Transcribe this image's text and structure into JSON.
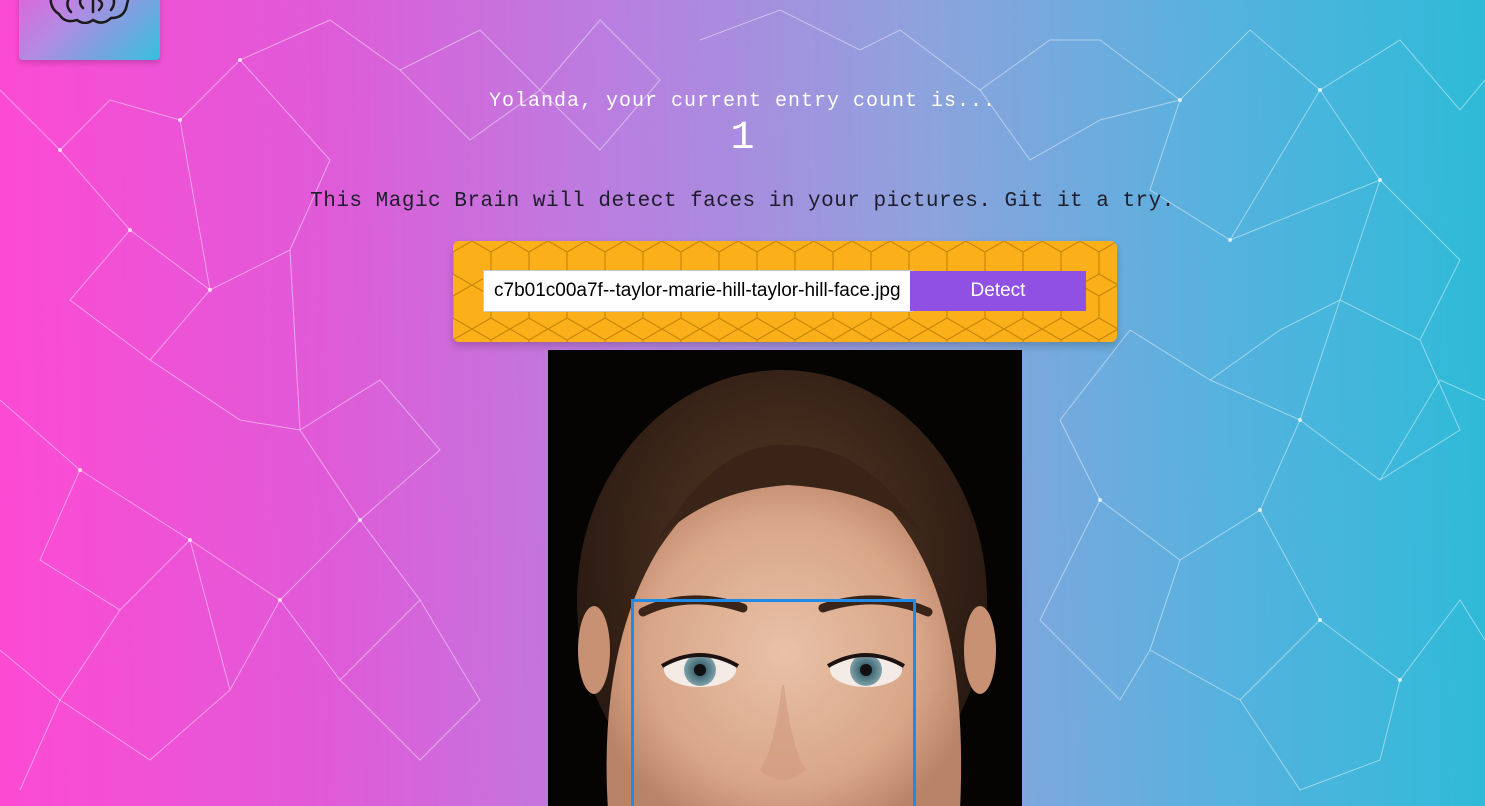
{
  "app": {
    "logo_icon": "brain-icon",
    "colors": {
      "gradient_start": "#fd4ad3",
      "gradient_end": "#2ebbd8",
      "form_background": "#fbb019",
      "button": "#9150e4",
      "bounding_box": "#1f8be8"
    }
  },
  "rank": {
    "greeting": "Yolanda, your current entry count is...",
    "count": "1"
  },
  "intro": {
    "text": "This Magic Brain will detect faces in your pictures. Git it a try."
  },
  "form": {
    "image_url_value": "c7b01c00a7f--taylor-marie-hill-taylor-hill-face.jpg",
    "detect_label": "Detect"
  },
  "result": {
    "face_box_icon": "face-bounding-box",
    "faces_shown": 1
  }
}
